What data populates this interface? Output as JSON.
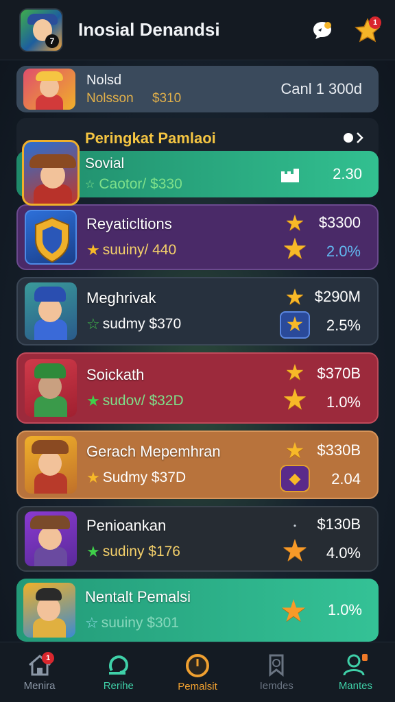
{
  "header": {
    "title": "Inosial Denandsi",
    "notification_count": "1",
    "icons": [
      "chat-bubble-icon",
      "star-icon"
    ]
  },
  "pinned": {
    "name": "Nolsd",
    "sub_name": "Nolsson",
    "sub_value": "$310",
    "right_text": "Canl 1 300d"
  },
  "section": {
    "title": "Peringkat Pamlaoi"
  },
  "rows": [
    {
      "name": "Sovial",
      "sub": "Caotor/ $330",
      "amount": "",
      "pct": "2.30",
      "bg": "#2fae86"
    },
    {
      "name": "Reyaticltions",
      "sub": "suuiny/ 440",
      "amount": "$3300",
      "pct": "2.0%",
      "bg": "#4a2a68"
    },
    {
      "name": "Meghrivak",
      "sub": "sudmy $370",
      "amount": "$290M",
      "pct": "2.5%",
      "bg": "#2a3442"
    },
    {
      "name": "Soickath",
      "sub": "sudov/ $32D",
      "amount": "$370B",
      "pct": "1.0%",
      "bg": "#9c2a3c"
    },
    {
      "name": "Gerach Mepemhran",
      "sub": "Sudmy $37D",
      "amount": "$330B",
      "pct": "2.04",
      "bg": "#b8733c"
    },
    {
      "name": "Penioankan",
      "sub": "sudiny $176",
      "amount": "$130B",
      "pct": "4.0%",
      "bg": "#262c33"
    },
    {
      "name": "Nentalt Pemalsi",
      "sub": "suuiny $301",
      "amount": "",
      "pct": "1.0%",
      "bg": "#2fb08a"
    }
  ],
  "bottom_nav": [
    {
      "label": "Menira",
      "icon": "home-icon",
      "badge": "1",
      "color": "#8b97a6"
    },
    {
      "label": "Rerihe",
      "icon": "refresh-icon",
      "badge": "",
      "color": "#3fd0a8"
    },
    {
      "label": "Pemalsit",
      "icon": "timer-icon",
      "badge": "",
      "color": "#f0a030"
    },
    {
      "label": "Iemdes",
      "icon": "bookmark-icon",
      "badge": "",
      "color": "#6a7482"
    },
    {
      "label": "Mantes",
      "icon": "user-icon",
      "badge": "",
      "color": "#3fd0a8"
    }
  ],
  "colors": {
    "accent_gold": "#f5c542",
    "background": "#0e141c",
    "header": "#141a22"
  }
}
